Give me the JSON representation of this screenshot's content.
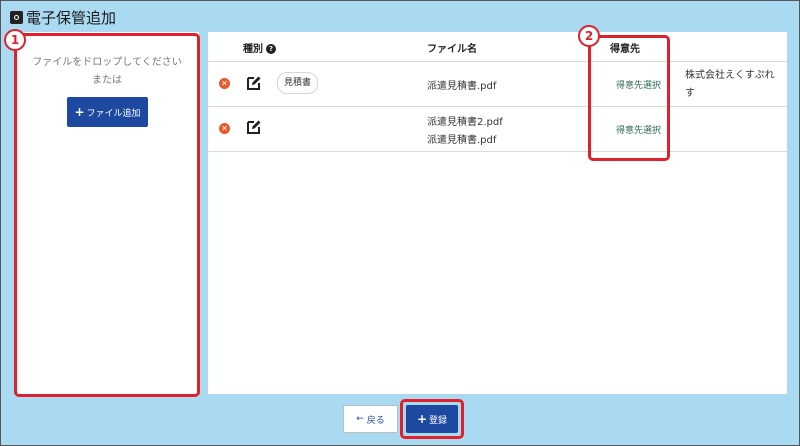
{
  "title": "電子保管追加",
  "drop_panel": {
    "instruction": "ファイルをドロップしてください",
    "or_text": "または",
    "add_button": "ファイル追加"
  },
  "table": {
    "headers": {
      "type": "種別",
      "file_name": "ファイル名",
      "client": "得意先"
    },
    "rows": [
      {
        "type_badge": "見積書",
        "files": [
          "派遣見積書.pdf"
        ],
        "client_link": "得意先選択",
        "client_name": [
          "株式会社えくすぷれ",
          "す"
        ]
      },
      {
        "type_badge": "",
        "files": [
          "派遣見積書2.pdf",
          "派遣見積書.pdf"
        ],
        "client_link": "得意先選択",
        "client_name": []
      }
    ]
  },
  "annotations": [
    "1",
    "2"
  ],
  "footer": {
    "back_label": "戻る",
    "register_label": "登録"
  },
  "colors": {
    "background": "#a9daf1",
    "primary": "#1d4aa0",
    "highlight": "#e0202a",
    "delete": "#e8572a",
    "link": "#2d6a52"
  }
}
